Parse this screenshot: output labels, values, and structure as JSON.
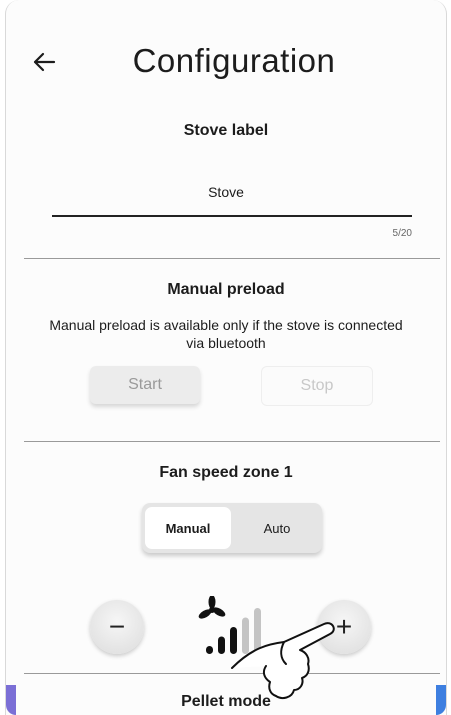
{
  "header": {
    "title": "Configuration"
  },
  "stove_label": {
    "heading": "Stove label",
    "value": "Stove",
    "counter": "5/20"
  },
  "manual_preload": {
    "heading": "Manual preload",
    "description": "Manual preload is available only if the stove is connected via bluetooth",
    "start_label": "Start",
    "stop_label": "Stop"
  },
  "fan_zone": {
    "heading": "Fan speed zone 1",
    "modes": [
      "Manual",
      "Auto"
    ],
    "selected_mode": "Manual",
    "minus_label": "−",
    "plus_label": "+",
    "speed_level": 3,
    "speed_max": 5
  },
  "next_section": {
    "heading": "Pellet mode"
  },
  "colors": {
    "accent_left": "#7b6fd6",
    "accent_right": "#3e7fe0",
    "divider": "#9a9a9a"
  },
  "icons": [
    "back-arrow-icon",
    "fan-icon",
    "speed-bars-icon",
    "hand-pointer-icon"
  ]
}
